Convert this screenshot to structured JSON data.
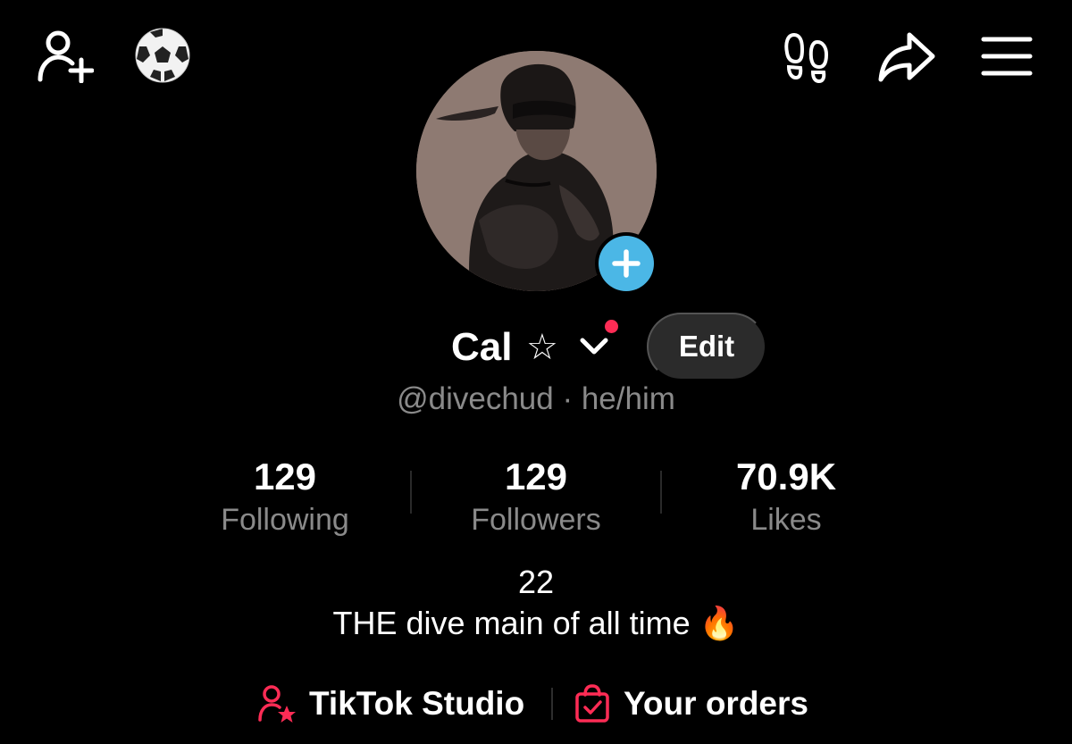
{
  "colors": {
    "accent_blue": "#4bb7e6",
    "notification_red": "#fe2c55",
    "muted_text": "#8a8a8a"
  },
  "header": {
    "left_icons": [
      "add-user-icon",
      "soccer-ball-icon"
    ],
    "right_icons": [
      "footprints-icon",
      "share-icon",
      "menu-icon"
    ]
  },
  "profile": {
    "display_name": "Cal",
    "name_star": "☆",
    "edit_label": "Edit",
    "handle": "@divechud",
    "pronouns_separator": "·",
    "pronouns": "he/him"
  },
  "stats": [
    {
      "value": "129",
      "label": "Following"
    },
    {
      "value": "129",
      "label": "Followers"
    },
    {
      "value": "70.9K",
      "label": "Likes"
    }
  ],
  "bio": {
    "line1": "22",
    "line2": "THE dive main of all time 🔥"
  },
  "links": {
    "studio_label": "TikTok Studio",
    "orders_label": "Your orders"
  }
}
